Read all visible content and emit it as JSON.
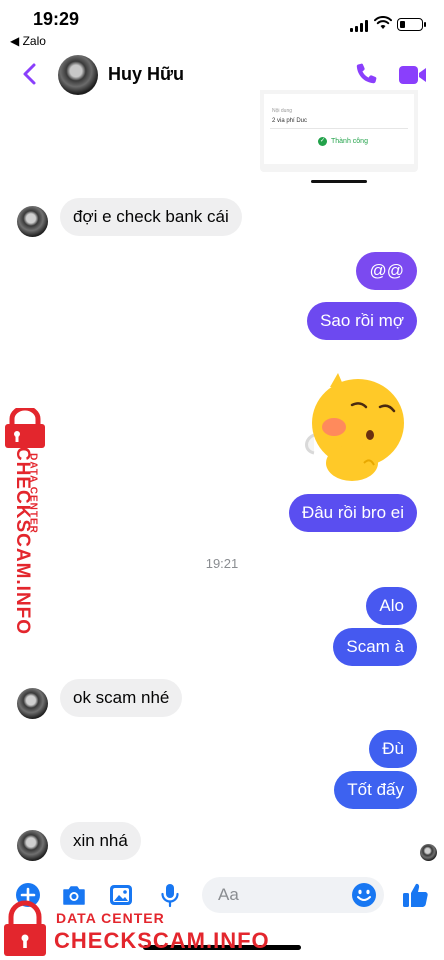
{
  "status_bar": {
    "time": "19:29",
    "back_app": "◀ Zalo",
    "battery_level": 0.25
  },
  "header": {
    "contact_name": "Huy Hữu"
  },
  "receipt": {
    "small_label": "Nội dung",
    "line": "2 via phí Duc",
    "status": "Thành công"
  },
  "messages": [
    {
      "side": "in",
      "text": "đợi e check bank cái"
    },
    {
      "side": "out",
      "text": "@@"
    },
    {
      "side": "out",
      "text": "Sao rồi mợ"
    },
    {
      "side": "out",
      "text": "Đâu rồi bro ei"
    },
    {
      "side": "out",
      "text": "Alo"
    },
    {
      "side": "out",
      "text": "Scam à"
    },
    {
      "side": "in",
      "text": "ok scam nhé"
    },
    {
      "side": "out",
      "text": "Đù"
    },
    {
      "side": "out",
      "text": "Tốt đấy"
    },
    {
      "side": "in",
      "text": "xin nhá"
    }
  ],
  "timestamp": "19:21",
  "composer": {
    "placeholder": "Aa"
  },
  "colors": {
    "accent": "#8a3ffc",
    "bubble_out_top": "#7b4af0",
    "bubble_out_mid": "#5a4ef0",
    "bubble_out_bottom": "#3f5ff0",
    "bubble_in": "#efeff0",
    "composer_blue": "#1877f2",
    "watermark_red": "#e3262d"
  },
  "watermark": {
    "small": "DATA CENTER",
    "big": "CHECKSCAM.INFO"
  },
  "icons": [
    "back-chevron-icon",
    "phone-icon",
    "video-camera-icon",
    "plus-icon",
    "camera-icon",
    "photo-icon",
    "microphone-icon",
    "emoji-icon",
    "thumbs-up-icon",
    "lock-icon"
  ]
}
